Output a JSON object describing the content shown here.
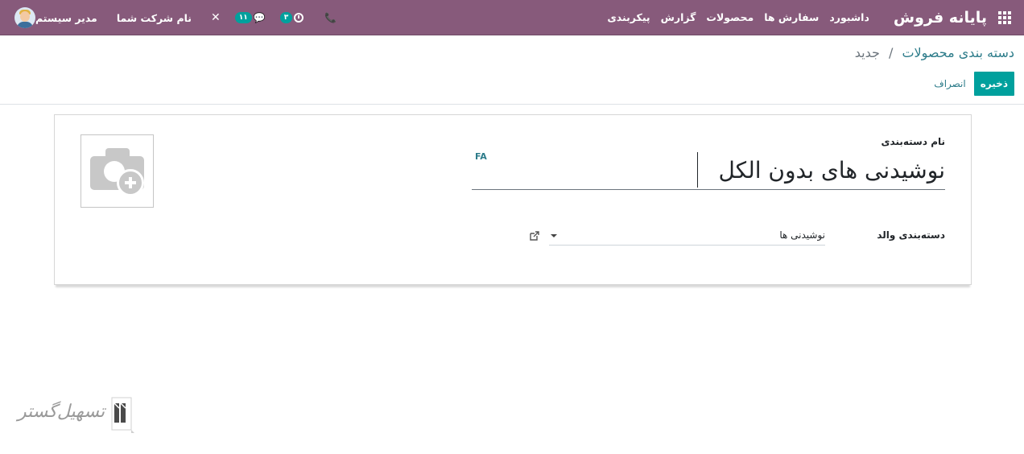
{
  "navbar": {
    "brand": "پایانه فروش",
    "menu": [
      "داشبورد",
      "سفارش ها",
      "محصولات",
      "گزارش",
      "پیکربندی"
    ],
    "activity_count": "۳",
    "message_count": "۱۱",
    "company": "نام شرکت شما",
    "user": "مدیر سیستم",
    "color": "#875a7b"
  },
  "breadcrumb": {
    "parent": "دسته بندی محصولات",
    "separator": "/",
    "current": "جدید"
  },
  "buttons": {
    "save": "ذخیره",
    "discard": "انصراف",
    "save_color": "#00a09d"
  },
  "form": {
    "name_label": "نام دسته‌بندی",
    "name_value": "نوشیدنی های بدون الکل",
    "lang": "FA",
    "parent_label": "دسته‌بندی والد",
    "parent_value": "نوشیدنی ها"
  },
  "watermark": {
    "text": "تسهیل‌گستر"
  }
}
